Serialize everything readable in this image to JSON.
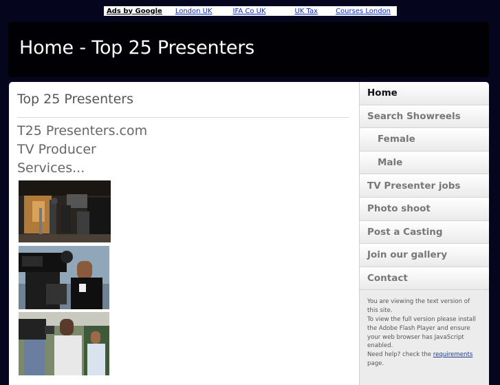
{
  "ads": {
    "label": "Ads by Google",
    "links": [
      "London UK",
      "IFA Co UK",
      "UK Tax",
      "Courses London"
    ]
  },
  "header": {
    "title": "Home - Top 25 Presenters"
  },
  "main": {
    "page_title": "Top 25 Presenters",
    "heading_lines": [
      "T25 Presenters.com",
      "TV Producer",
      "Services..."
    ]
  },
  "sidebar": {
    "items": [
      {
        "label": "Home"
      },
      {
        "label": "Search Showreels"
      },
      {
        "label": "Female"
      },
      {
        "label": "Male"
      },
      {
        "label": "TV Presenter jobs"
      },
      {
        "label": "Photo shoot"
      },
      {
        "label": "Post a Casting"
      },
      {
        "label": "Join our gallery"
      },
      {
        "label": "Contact"
      }
    ],
    "notice": {
      "line1": "You are viewing the text version of this site.",
      "line2": "To view the full version please install the Adobe Flash Player and ensure your web browser has JavaScript enabled.",
      "help_prefix": "Need help? check the",
      "help_link": "requirements",
      "help_suffix": "page."
    }
  },
  "colors": {
    "page_background": "#05051e",
    "header_background": "#000005",
    "link_blue": "#0b2cc9"
  }
}
